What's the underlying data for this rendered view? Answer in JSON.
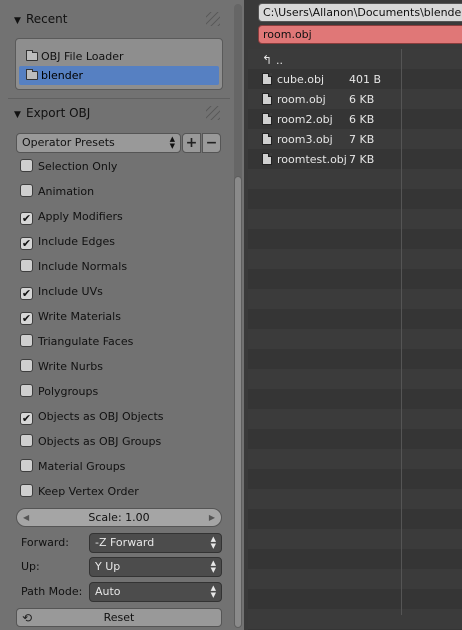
{
  "left_panel": {
    "recent": {
      "title": "Recent",
      "items": [
        {
          "label": "OBJ File Loader",
          "active": false
        },
        {
          "label": "blender",
          "active": true
        }
      ]
    },
    "export": {
      "title": "Export OBJ",
      "operator_presets": "Operator Presets",
      "add_preset_icon": "plus-icon",
      "remove_preset_icon": "minus-icon",
      "options": [
        {
          "label": "Selection Only",
          "checked": false
        },
        {
          "label": "Animation",
          "checked": false
        },
        {
          "label": "Apply Modifiers",
          "checked": true
        },
        {
          "label": "Include Edges",
          "checked": true
        },
        {
          "label": "Include Normals",
          "checked": false
        },
        {
          "label": "Include UVs",
          "checked": true
        },
        {
          "label": "Write Materials",
          "checked": true
        },
        {
          "label": "Triangulate Faces",
          "checked": false
        },
        {
          "label": "Write Nurbs",
          "checked": false
        },
        {
          "label": "Polygroups",
          "checked": false
        },
        {
          "label": "Objects as OBJ Objects",
          "checked": true
        },
        {
          "label": "Objects as OBJ Groups",
          "checked": false
        },
        {
          "label": "Material Groups",
          "checked": false
        },
        {
          "label": "Keep Vertex Order",
          "checked": false
        }
      ],
      "scale": "Scale: 1.00",
      "forward": {
        "label": "Forward:",
        "value": "-Z Forward"
      },
      "up": {
        "label": "Up:",
        "value": "Y Up"
      },
      "path_mode": {
        "label": "Path Mode:",
        "value": "Auto"
      },
      "reset": "Reset"
    }
  },
  "file_browser": {
    "path": "C:\\Users\\Allanon\\Documents\\blender\\",
    "filename": "room.obj",
    "parent": "..",
    "files": [
      {
        "name": "cube.obj",
        "size": "401 B"
      },
      {
        "name": "room.obj",
        "size": "6 KB"
      },
      {
        "name": "room2.obj",
        "size": "6 KB"
      },
      {
        "name": "room3.obj",
        "size": "7 KB"
      },
      {
        "name": "roomtest.obj",
        "size": "7 KB"
      }
    ]
  },
  "colors": {
    "panel_bg": "#727272",
    "selection": "#5680c2",
    "filename_field": "#e07777",
    "browser_bg": "#3a3a3a"
  }
}
